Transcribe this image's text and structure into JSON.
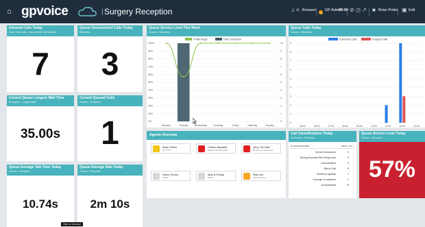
{
  "topbar": {
    "logo": "gpvoice",
    "separator": "|",
    "title": "Surgery Reception",
    "browser_label": "Browser",
    "status_label": "GP Admin",
    "status_time": "00:00",
    "user_name": "Brian Potter",
    "edit_label": "Edit",
    "status_color": "#f5a623"
  },
  "cards": {
    "inbound": {
      "title": "Inbound Calls Today",
      "subtitle": "Total Calls Today - Inbound (All Call Options)",
      "value": "7"
    },
    "unconnected": {
      "title": "Queue Unconnected Calls Today",
      "subtitle": "Reception",
      "value": "3"
    },
    "longest_wait": {
      "title": "Current Queue Longest Wait Time",
      "subtitle": "Reception - Longest Wait",
      "value": "35.00s"
    },
    "queued": {
      "title": "Current Queued Calls",
      "subtitle": "Doctors - Reception",
      "value": "1"
    },
    "avg_talk": {
      "title": "Queue Average Talk Time Today",
      "subtitle": "Doctors - Reception",
      "value": "10.74s"
    },
    "avg_wait": {
      "title": "Queue Average Wait Today",
      "subtitle": "Doctors - Reception",
      "value": "2m 10s"
    }
  },
  "service_week": {
    "title": "Queue Service Level This Week",
    "subtitle": "Doctors - Reception",
    "legend": [
      "% Met Target",
      "Calls Connected"
    ]
  },
  "queue_calls": {
    "title": "Queue Calls Today",
    "subtitle": "Doctors - Reception",
    "legend": [
      "Connected Calls",
      "Dropped Calls"
    ]
  },
  "agents": {
    "title": "Agents Overview",
    "items": [
      {
        "name": "Brian Potter",
        "status": "GP Admin",
        "color": "#f5c518"
      },
      {
        "name": "Clinton Baptiste",
        "status": "Break Time Exceeded",
        "color": "#e02020"
      },
      {
        "name": "Jerry \"St Clair\"",
        "status": "Break Time Exceeded",
        "color": "#e02020"
      },
      {
        "name": "Henry Senior",
        "status": "Offline",
        "color": "#d8d8d8"
      },
      {
        "name": "Max & Paddy",
        "status": "Offline",
        "color": "#d8d8d8"
      },
      {
        "name": "Ray Von",
        "status": "Team Meeting",
        "color": "#f5a623"
      }
    ]
  },
  "classifications": {
    "title": "Call Classifications Today",
    "subtitle": "All Doctors - Reception",
    "headers": [
      "CLASSIFICATIONS",
      "TOTAL CAL..."
    ],
    "rows": [
      {
        "label": "Great Interaction",
        "value": "0"
      },
      {
        "label": "Wrong Number/No Response",
        "value": "0"
      },
      {
        "label": "Cancellation",
        "value": "3"
      },
      {
        "label": "Silent Call",
        "value": "0"
      },
      {
        "label": "Referral update",
        "value": "1"
      },
      {
        "label": "Change of address",
        "value": "1"
      },
      {
        "label": "Unclassified",
        "value": "8"
      }
    ]
  },
  "service_today": {
    "title": "Queue Service Level Today",
    "subtitle": "Doctors - Reception",
    "value": "57%",
    "color": "#c8202f"
  },
  "tooltip": "Help on Inbound",
  "chart_data": [
    {
      "type": "bar",
      "title": "Queue Service Level This Week",
      "categories": [
        "Monday",
        "Tuesday",
        "Wednesday",
        "Thursday",
        "Friday",
        "Saturday",
        "Sunday"
      ],
      "series": [
        {
          "name": "% Met Target",
          "type": "line",
          "axis": "left",
          "values": [
            100,
            57,
            100,
            100,
            100,
            100,
            100
          ]
        },
        {
          "name": "Calls Connected",
          "type": "bar",
          "axis": "right",
          "values": [
            0,
            10,
            0,
            0,
            0,
            0,
            0
          ]
        }
      ],
      "y_left_ticks": [
        "0%",
        "10%",
        "20%",
        "30%",
        "40%",
        "50%",
        "60%",
        "70%",
        "80%",
        "90%",
        "100%"
      ],
      "y_right_ticks": [
        "0",
        "1",
        "2",
        "3",
        "4",
        "5",
        "6",
        "7",
        "8",
        "9",
        "10"
      ],
      "ylim_left": [
        0,
        100
      ],
      "ylim_right": [
        0,
        10
      ],
      "legend": "top-center"
    },
    {
      "type": "bar",
      "title": "Queue Calls Today",
      "categories": [
        "05:00",
        "06:00",
        "07:00",
        "08:00",
        "09:00",
        "10:00",
        "11:00",
        "12:00",
        "13:00"
      ],
      "series": [
        {
          "name": "Connected Calls",
          "values": [
            0,
            0,
            0,
            0,
            0,
            0,
            2,
            9,
            0
          ]
        },
        {
          "name": "Dropped Calls",
          "values": [
            0,
            0,
            0,
            0,
            0,
            0,
            0,
            3,
            0
          ]
        }
      ],
      "y_ticks": [
        "0",
        "1",
        "2",
        "3",
        "4",
        "5",
        "6",
        "7",
        "8",
        "9"
      ],
      "ylim": [
        0,
        9
      ],
      "legend": "top-right"
    }
  ]
}
